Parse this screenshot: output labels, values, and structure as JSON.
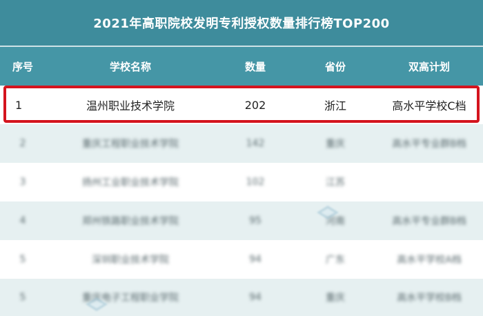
{
  "title": "2021年高职院校发明专利授权数量排行榜TOP200",
  "columns": [
    "序号",
    "学校名称",
    "数量",
    "省份",
    "双高计划"
  ],
  "highlight_row": {
    "rank": "1",
    "school": "温州职业技术学院",
    "count": "202",
    "province": "浙江",
    "plan": "高水平学校C档"
  },
  "rows": [
    {
      "rank": "2",
      "school": "重庆工程职业技术学院",
      "count": "142",
      "province": "重庆",
      "plan": "高水平专业群B档"
    },
    {
      "rank": "3",
      "school": "扬州工业职业技术学院",
      "count": "102",
      "province": "江苏",
      "plan": ""
    },
    {
      "rank": "4",
      "school": "郑州铁路职业技术学院",
      "count": "95",
      "province": "河南",
      "plan": "高水平专业群B档"
    },
    {
      "rank": "5",
      "school": "深圳职业技术学院",
      "count": "94",
      "province": "广东",
      "plan": "高水平学校A档"
    },
    {
      "rank": "5",
      "school": "重庆电子工程职业学院",
      "count": "94",
      "province": "重庆",
      "plan": "高水平学校B档"
    }
  ],
  "colors": {
    "title_bg": "#3e8c9c",
    "header_bg": "#4596a6",
    "alt_row": "#e6f0f1",
    "highlight_border": "#d4141e"
  }
}
